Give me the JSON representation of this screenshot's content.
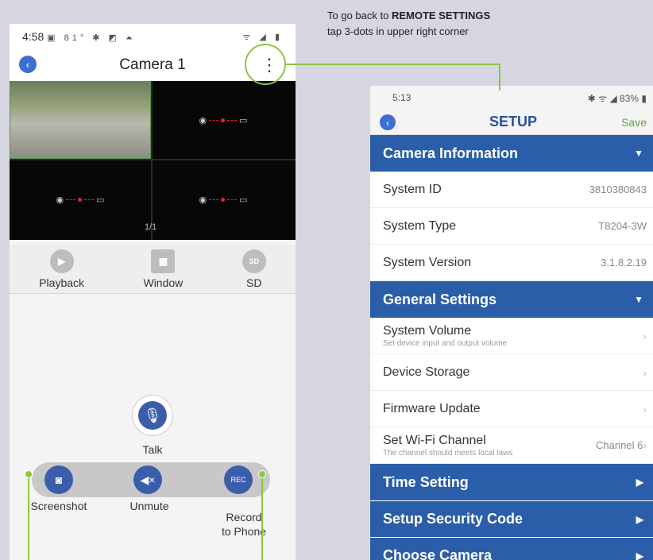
{
  "annotation": {
    "line1_prefix": "To go back to ",
    "line1_bold": "REMOTE SETTINGS",
    "line2": "tap 3-dots in upper right corner"
  },
  "left_phone": {
    "status_time": "4:58",
    "status_icons": "▣ 81° ✱ ◩ ⏶",
    "status_right": "ᯤ ◢ ▮",
    "back_icon": "‹",
    "title": "Camera 1",
    "kebab": "⋮",
    "page_indicator": "1/1",
    "tools": [
      {
        "label": "Playback",
        "icon": "play-icon"
      },
      {
        "label": "Window",
        "icon": "grid-icon"
      },
      {
        "label": "SD",
        "icon": "sd-hd-icon"
      }
    ],
    "talk_label": "Talk",
    "bottom": {
      "screenshot": "Screenshot",
      "unmute": "Unmute",
      "record_line1": "Record",
      "record_line2": "to Phone"
    }
  },
  "right_phone": {
    "status_time": "5:13",
    "status_right": "✱ ᯤ ◢ 83% ▮",
    "title": "SETUP",
    "save": "Save",
    "sections": {
      "camera_info": "Camera Information",
      "general": "General Settings",
      "time": "Time Setting",
      "security": "Setup Security Code",
      "choose": "Choose Camera"
    },
    "rows": {
      "system_id_label": "System ID",
      "system_id_value": "3810380843",
      "system_type_label": "System Type",
      "system_type_value": "T8204-3W",
      "system_version_label": "System Version",
      "system_version_value": "3.1.8.2.19",
      "volume_label": "System Volume",
      "volume_sub": "Set device input and output volume",
      "storage_label": "Device Storage",
      "firmware_label": "Firmware Update",
      "wifi_label": "Set Wi-Fi Channel",
      "wifi_sub": "The channel should meets local laws",
      "wifi_value": "Channel 6"
    }
  },
  "colors": {
    "accent_green": "#8cc63f",
    "header_blue": "#2a5ea8",
    "button_blue": "#3b5dab",
    "save_green": "#55a83a"
  }
}
